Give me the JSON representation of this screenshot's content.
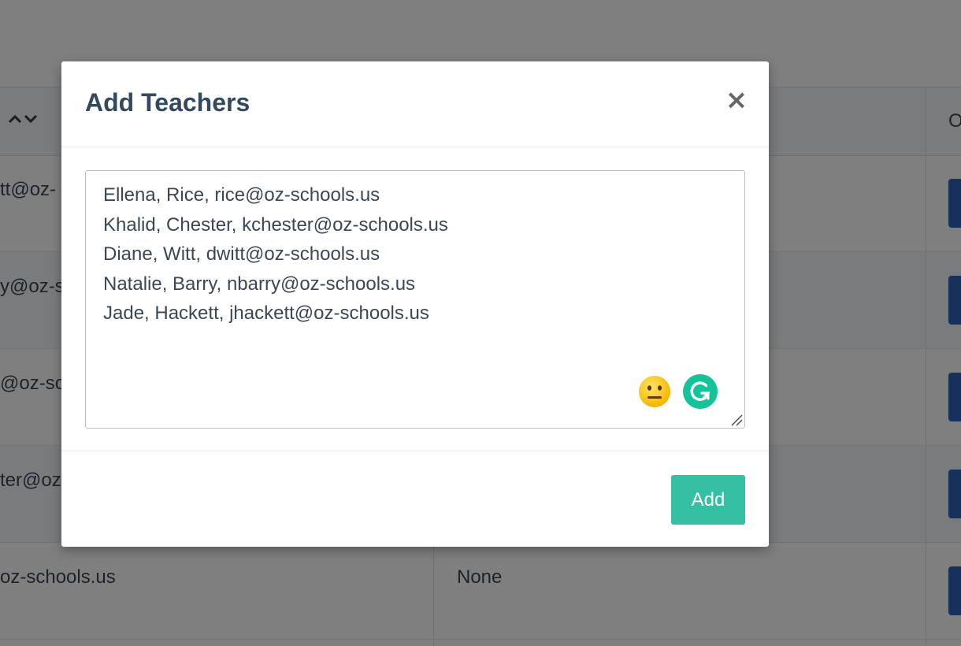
{
  "background_table": {
    "rows": [
      {
        "email": "tt@oz-",
        "role": ""
      },
      {
        "email": "y@oz-sc",
        "role": ""
      },
      {
        "email": "@oz-sch",
        "role": ""
      },
      {
        "email": "ter@oz-",
        "role": ""
      },
      {
        "email": "oz-schools.us",
        "role": "None"
      }
    ],
    "clipped_header": "O"
  },
  "modal": {
    "title": "Add Teachers",
    "close_label": "×",
    "textarea_value": "Ellena, Rice, rice@oz-schools.us\nKhalid, Chester, kchester@oz-schools.us\nDiane, Witt, dwitt@oz-schools.us\nNatalie, Barry, nbarry@oz-schools.us\nJade, Hackett, jhackett@oz-schools.us",
    "add_label": "Add"
  },
  "colors": {
    "overlay": "rgba(0,0,0,0.5)",
    "add_button": "#35bfa3",
    "title": "#34495e",
    "grammarly": "#15c39a",
    "action_button": "#2c63b8"
  },
  "icons": {
    "sort": "sort-up-down-icon",
    "close": "close-icon",
    "emoji": "neutral-face-icon",
    "grammarly": "grammarly-icon",
    "resize": "resize-handle-icon"
  }
}
